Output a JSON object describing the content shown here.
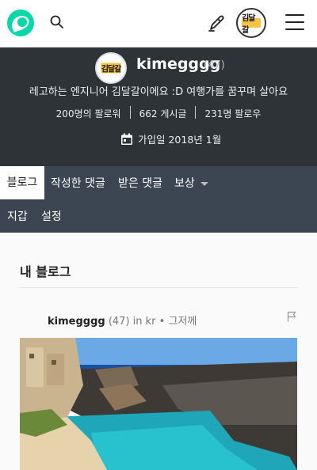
{
  "header": {
    "logo_icon": "steemit-logo-icon",
    "search_icon": "search-icon",
    "pen_icon": "pen-icon",
    "menu_icon": "hamburger-icon",
    "avatar_text": "김달갈"
  },
  "profile": {
    "avatar_text": "김달갈",
    "name": "kimegggg",
    "reputation": "(47)",
    "about": "레고하는 엔지니어 김달갈이에요 :D 여행가를 꿈꾸며 살아요",
    "followers": "200명의 팔로워",
    "posts": "662 게시글",
    "following": "231명 팔로우",
    "joined": "가입일 2018년 1월"
  },
  "tabs": {
    "blog": "블로그",
    "comments": "작성한 댓글",
    "replies": "받은 댓글",
    "rewards": "보상",
    "wallet": "지갑",
    "settings": "설정"
  },
  "main": {
    "section_title": "내 블로그",
    "post": {
      "author": "kimegggg",
      "reputation": "(47)",
      "community": "in kr",
      "time": "• 그저께"
    }
  },
  "colors": {
    "accent": "#07d7a9",
    "hero_bg": "#2e3338",
    "tab_bg": "#3b4652"
  }
}
